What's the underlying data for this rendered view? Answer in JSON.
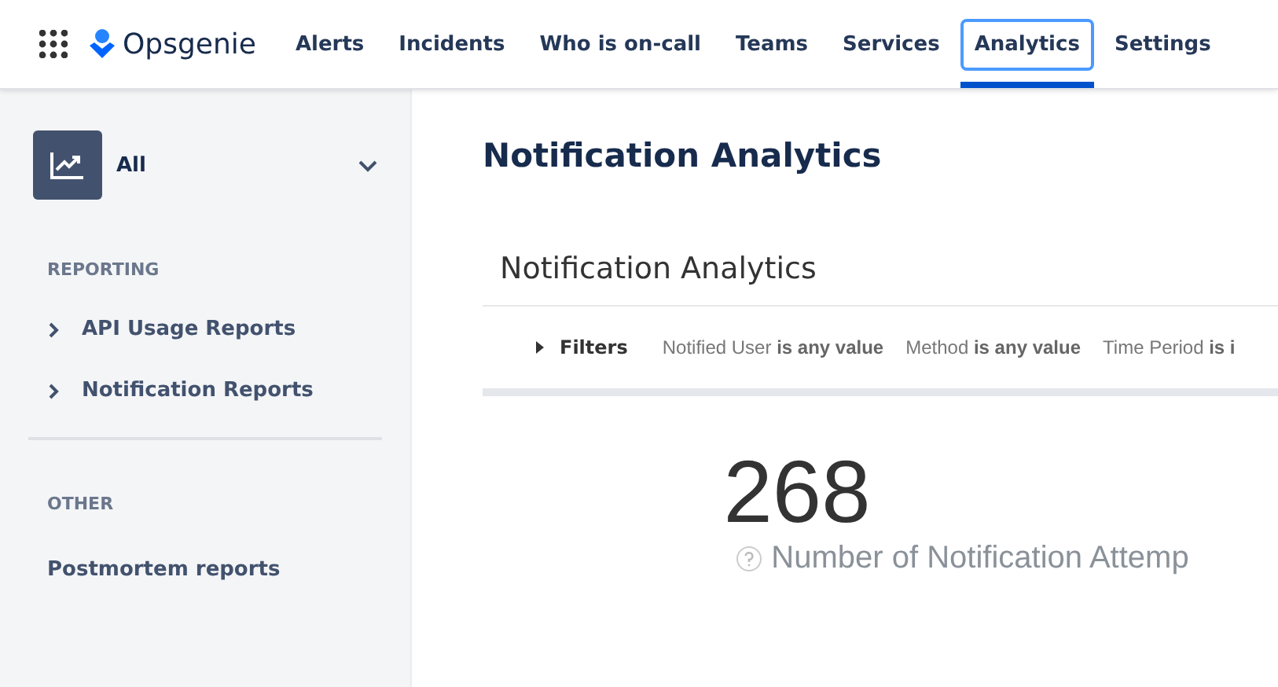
{
  "brand": "Opsgenie",
  "nav": [
    {
      "label": "Alerts",
      "selected": false
    },
    {
      "label": "Incidents",
      "selected": false
    },
    {
      "label": "Who is on-call",
      "selected": false
    },
    {
      "label": "Teams",
      "selected": false
    },
    {
      "label": "Services",
      "selected": false
    },
    {
      "label": "Analytics",
      "selected": true
    },
    {
      "label": "Settings",
      "selected": false
    }
  ],
  "sidebar": {
    "selector": "All",
    "sections": [
      {
        "heading": "REPORTING",
        "items": [
          {
            "label": "API Usage Reports",
            "expandable": true
          },
          {
            "label": "Notification Reports",
            "expandable": true
          }
        ]
      },
      {
        "heading": "OTHER",
        "items": [
          {
            "label": "Postmortem reports",
            "expandable": false
          }
        ]
      }
    ]
  },
  "page_title": "Notification Analytics",
  "card": {
    "title": "Notification Analytics",
    "filters_label": "Filters",
    "filters": [
      "Notified User **is any value**",
      "Method **is any value**",
      "Time Period **is i**"
    ],
    "metric": {
      "value": "268",
      "label": "Number of Notification Attemp"
    }
  }
}
